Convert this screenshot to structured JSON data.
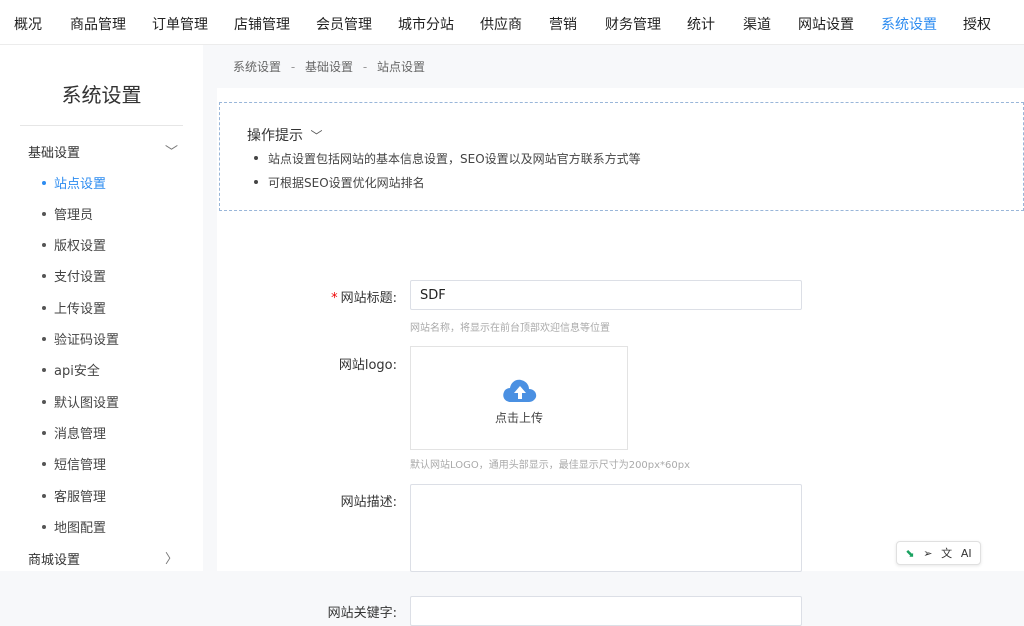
{
  "topnav": {
    "items": [
      "概况",
      "商品管理",
      "订单管理",
      "店铺管理",
      "会员管理",
      "城市分站",
      "供应商",
      "营销",
      "财务管理",
      "统计",
      "渠道",
      "网站设置",
      "系统设置",
      "授权"
    ],
    "active": "系统设置",
    "active_color": "#2d8cf0"
  },
  "sidebar": {
    "title": "系统设置",
    "group1": "基础设置",
    "items": [
      "站点设置",
      "管理员",
      "版权设置",
      "支付设置",
      "上传设置",
      "验证码设置",
      "api安全",
      "默认图设置",
      "消息管理",
      "短信管理",
      "客服管理",
      "地图配置"
    ],
    "group2": "商城设置"
  },
  "breadcrumb": {
    "level1": "系统设置",
    "level2": "基础设置",
    "level3": "站点设置",
    "sep": "-"
  },
  "tips": {
    "title": "操作提示",
    "items": [
      "站点设置包括网站的基本信息设置，SEO设置以及网站官方联系方式等",
      "可根据SEO设置优化网站排名"
    ]
  },
  "form": {
    "site_title_label": "网站标题:",
    "site_title_value": "SDF",
    "site_title_hint": "网站名称，将显示在前台顶部欢迎信息等位置",
    "logo_label": "网站logo:",
    "upload_label": "点击上传",
    "logo_hint": "默认网站LOGO，通用头部显示，最佳显示尺寸为200px*60px",
    "desc_label": "网站描述:",
    "keywords_label": "网站关键字:"
  },
  "float_toolbar": {
    "ai_label": "AI"
  },
  "colors": {
    "accent": "#2d8cf0",
    "cloud": "#4a90e2",
    "required": "#e00000"
  }
}
